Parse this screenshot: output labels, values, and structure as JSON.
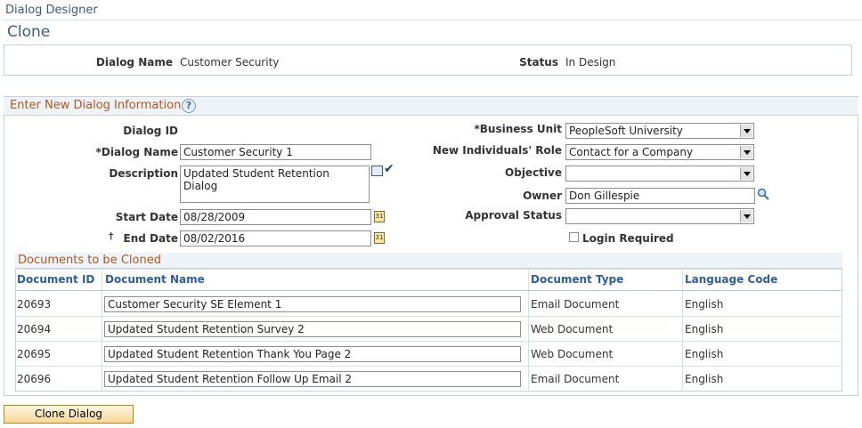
{
  "breadcrumb": "Dialog Designer",
  "page_title": "Clone",
  "header": {
    "dialog_name_label": "Dialog Name",
    "dialog_name_value": "Customer Security",
    "status_label": "Status",
    "status_value": "In Design"
  },
  "section": {
    "title": "Enter New Dialog Information",
    "help_icon": "?"
  },
  "form": {
    "dialog_id_label": "Dialog ID",
    "dialog_name_label": "*Dialog Name",
    "dialog_name_value": "Customer Security 1",
    "description_label": "Description",
    "description_value": "Updated Student Retention Dialog",
    "start_date_label": "Start Date",
    "start_date_value": "08/28/2009",
    "end_date_marker": "†",
    "end_date_label": "End Date",
    "end_date_value": "08/02/2016",
    "business_unit_label": "*Business Unit",
    "business_unit_value": "PeopleSoft University",
    "individuals_role_label": "New Individuals' Role",
    "individuals_role_value": "Contact for a Company",
    "objective_label": "Objective",
    "objective_value": "",
    "owner_label": "Owner",
    "owner_value": "Don Gillespie",
    "approval_status_label": "Approval Status",
    "approval_status_value": "",
    "login_required_label": "Login Required",
    "calendar_icon_text": "31"
  },
  "documents": {
    "title": "Documents to be Cloned",
    "columns": [
      "Document ID",
      "Document Name",
      "Document Type",
      "Language Code"
    ],
    "rows": [
      {
        "id": "20693",
        "name": "Customer Security SE Element 1",
        "type": "Email Document",
        "lang": "English"
      },
      {
        "id": "20694",
        "name": "Updated Student Retention Survey 2",
        "type": "Web Document",
        "lang": "English"
      },
      {
        "id": "20695",
        "name": "Updated Student Retention Thank You Page 2",
        "type": "Web Document",
        "lang": "English"
      },
      {
        "id": "20696",
        "name": "Updated Student Retention Follow Up Email 2",
        "type": "Email Document",
        "lang": "English"
      }
    ]
  },
  "clone_button": "Clone Dialog",
  "icons": {
    "calendar": "calendar-icon",
    "lookup": "search-icon",
    "expand_text": "expand-icon",
    "spellcheck": "spellcheck-icon",
    "help": "help-icon"
  }
}
